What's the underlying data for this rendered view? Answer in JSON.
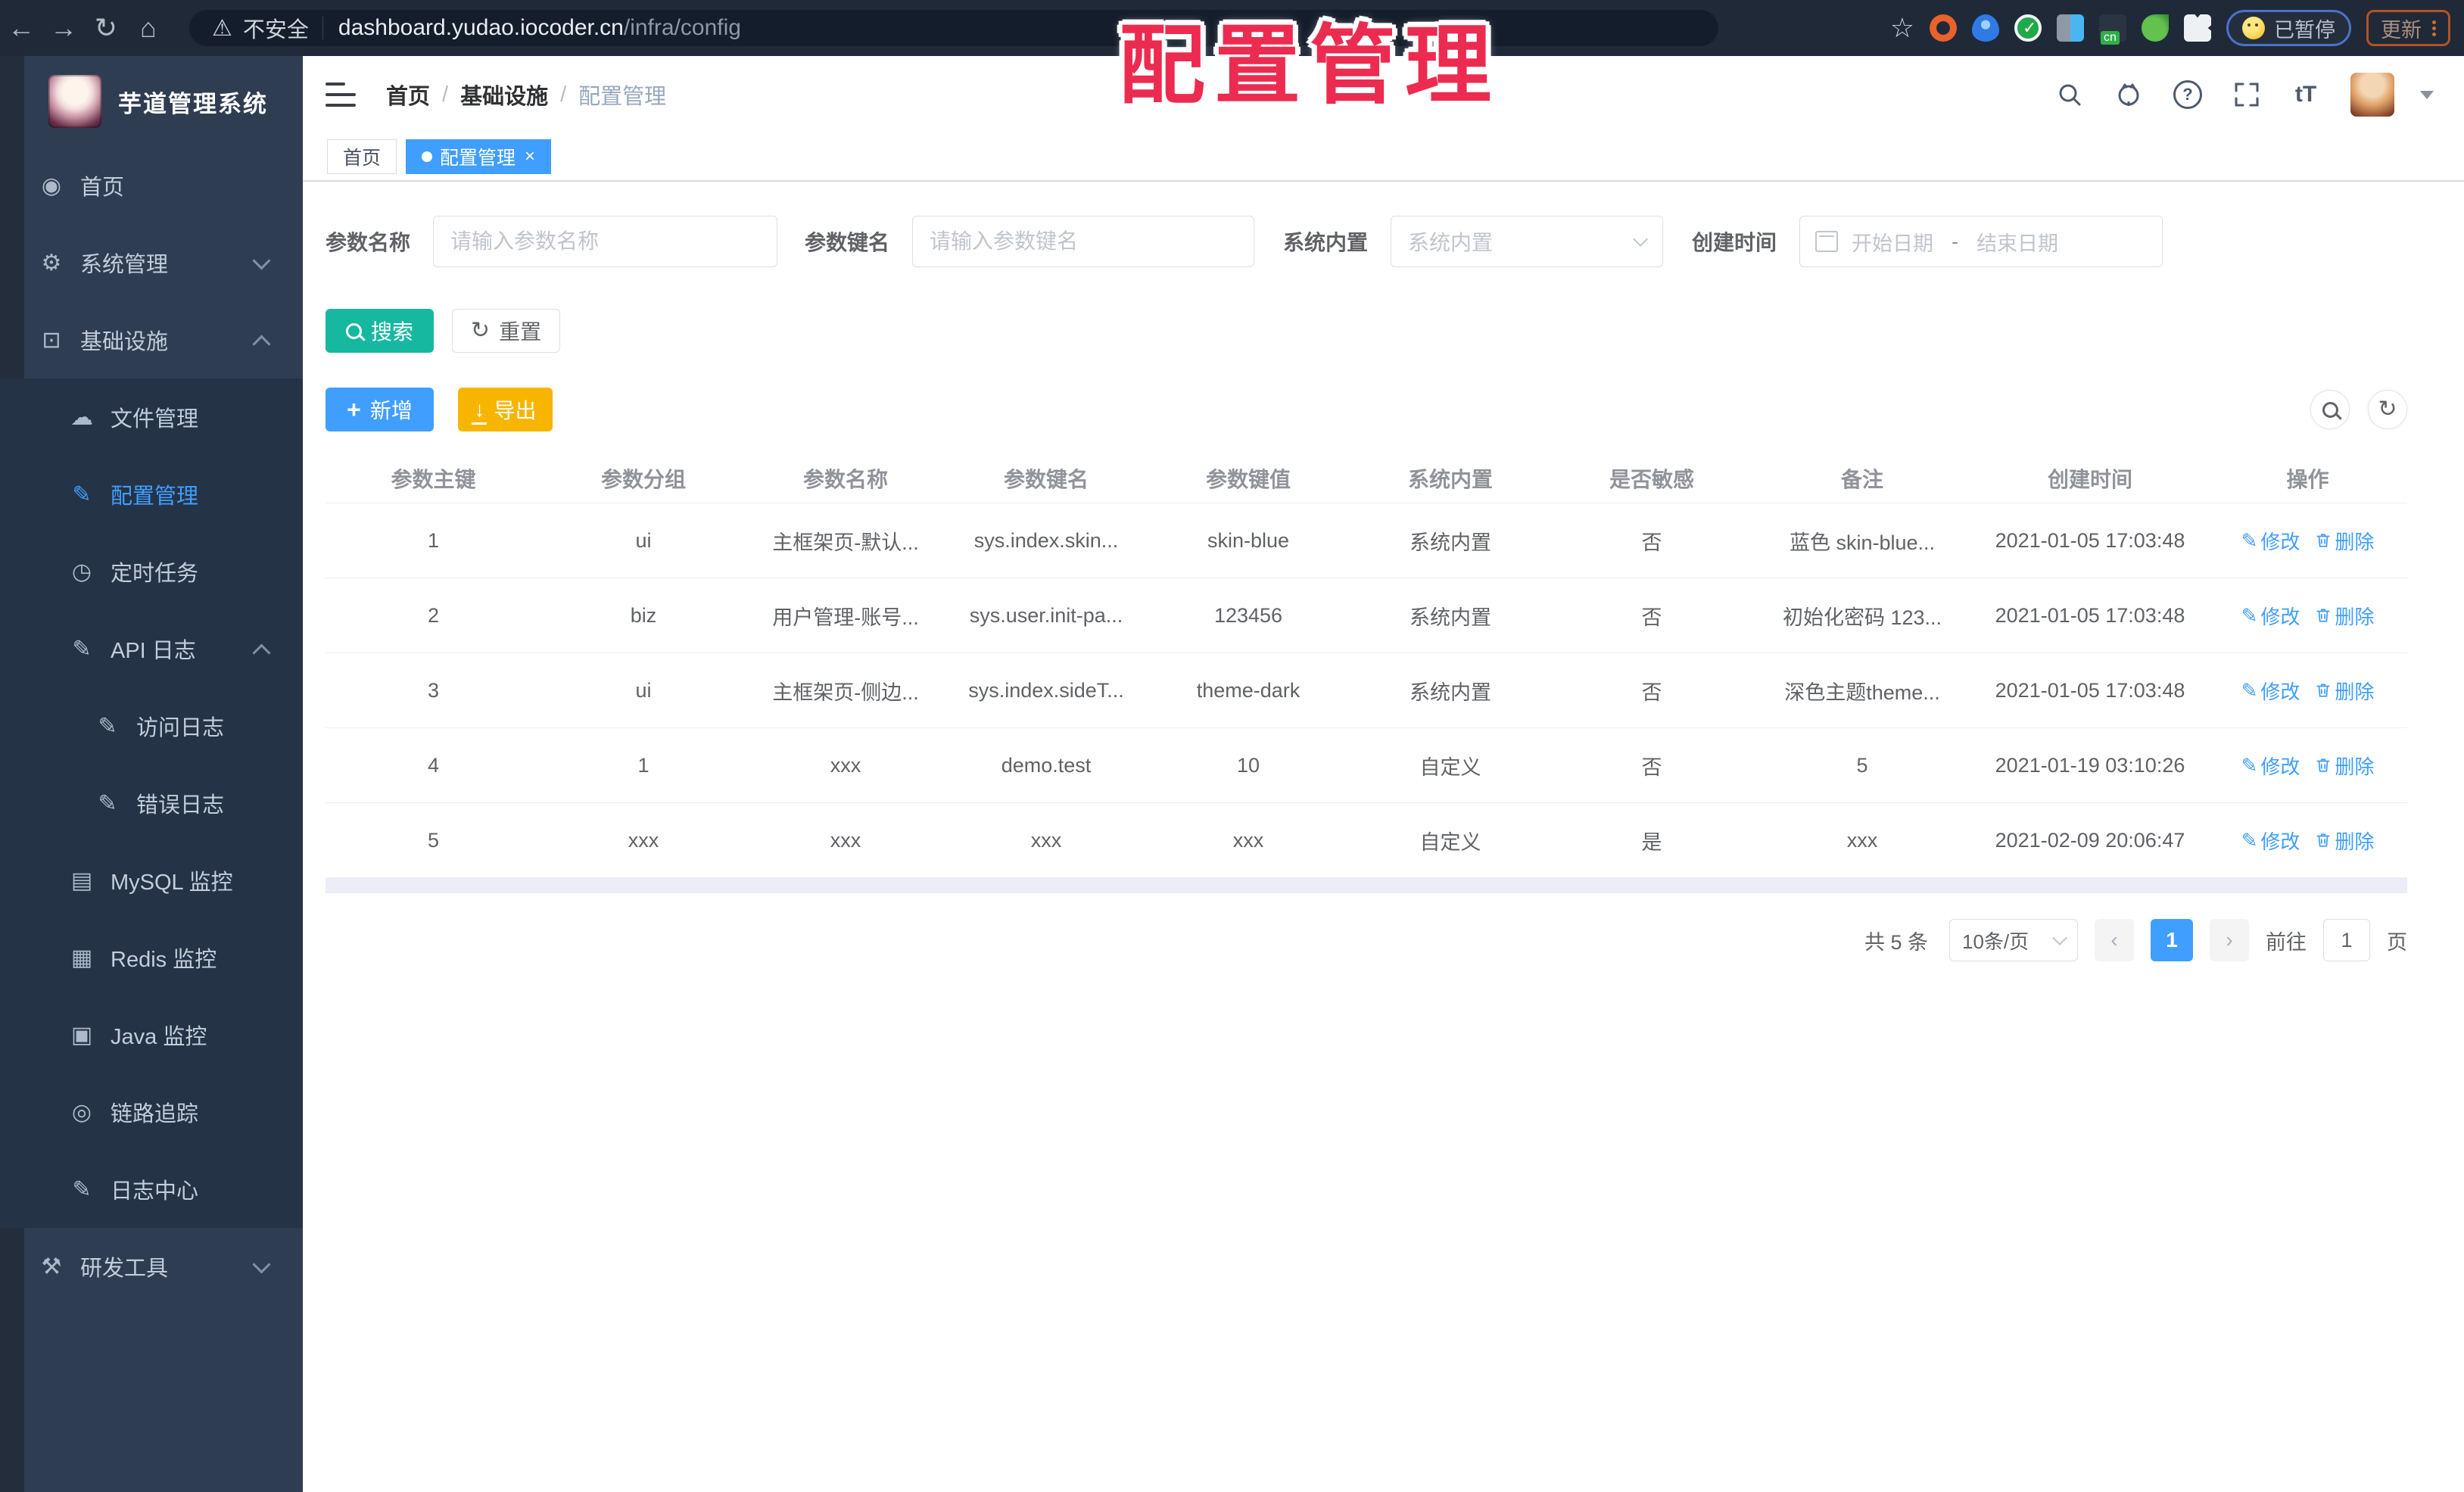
{
  "browser": {
    "security_label": "不安全",
    "url_host": "dashboard.yudao.iocoder.cn",
    "url_path": "/infra/config",
    "cn_badge": "cn",
    "paused_label": "已暂停",
    "update_label": "更新"
  },
  "overlay_title": "配置管理",
  "colors": {
    "accent_blue": "#409eff",
    "search_teal": "#16b8a0",
    "export_yellow": "#f7b500",
    "overlay_red": "#ec2b50",
    "sidebar_bg": "#2f3d52",
    "submenu_bg": "#243346"
  },
  "sidebar": {
    "app_title": "芋道管理系统",
    "menu": [
      {
        "id": "home",
        "label": "首页",
        "icon": "dashboard-icon",
        "level": 1
      },
      {
        "id": "system",
        "label": "系统管理",
        "icon": "gear-icon",
        "level": 1,
        "chevron": "down"
      },
      {
        "id": "infra",
        "label": "基础设施",
        "icon": "infra-monitor-icon",
        "level": 1,
        "chevron": "up"
      },
      {
        "id": "file",
        "label": "文件管理",
        "icon": "cloud-upload-icon",
        "level": 2,
        "group": true
      },
      {
        "id": "config",
        "label": "配置管理",
        "icon": "config-edit-icon",
        "level": 2,
        "group": true,
        "active": true
      },
      {
        "id": "job",
        "label": "定时任务",
        "icon": "timer-icon",
        "level": 2,
        "group": true
      },
      {
        "id": "api-log",
        "label": "API 日志",
        "icon": "api-log-icon",
        "level": 2,
        "group": true,
        "chevron": "up"
      },
      {
        "id": "access-log",
        "label": "访问日志",
        "icon": "access-log-icon",
        "level": 3,
        "group": true
      },
      {
        "id": "error-log",
        "label": "错误日志",
        "icon": "error-log-icon",
        "level": 3,
        "group": true
      },
      {
        "id": "mysql",
        "label": "MySQL 监控",
        "icon": "mysql-monitor-icon",
        "level": 2,
        "group": true
      },
      {
        "id": "redis",
        "label": "Redis 监控",
        "icon": "redis-monitor-icon",
        "level": 2,
        "group": true
      },
      {
        "id": "java",
        "label": "Java 监控",
        "icon": "java-monitor-icon",
        "level": 2,
        "group": true
      },
      {
        "id": "trace",
        "label": "链路追踪",
        "icon": "trace-eye-icon",
        "level": 2,
        "group": true
      },
      {
        "id": "log-center",
        "label": "日志中心",
        "icon": "log-center-icon",
        "level": 2,
        "group": true
      },
      {
        "id": "devtools",
        "label": "研发工具",
        "icon": "devtools-icon",
        "level": 1,
        "chevron": "down"
      }
    ]
  },
  "breadcrumb": [
    "首页",
    "基础设施",
    "配置管理"
  ],
  "tabs": [
    {
      "label": "首页",
      "active": false
    },
    {
      "label": "配置管理",
      "active": true
    }
  ],
  "filters": {
    "name_label": "参数名称",
    "name_placeholder": "请输入参数名称",
    "key_label": "参数键名",
    "key_placeholder": "请输入参数键名",
    "type_label": "系统内置",
    "type_placeholder": "系统内置",
    "date_label": "创建时间",
    "date_start_placeholder": "开始日期",
    "date_separator": "-",
    "date_end_placeholder": "结束日期",
    "search_button": "搜索",
    "reset_button": "重置"
  },
  "toolbar": {
    "add_button": "新增",
    "export_button": "导出"
  },
  "table": {
    "columns": [
      "参数主键",
      "参数分组",
      "参数名称",
      "参数键名",
      "参数键值",
      "系统内置",
      "是否敏感",
      "备注",
      "创建时间",
      "操作"
    ],
    "edit_label": "修改",
    "delete_label": "删除",
    "rows": [
      {
        "id": "1",
        "group": "ui",
        "name": "主框架页-默认...",
        "key": "sys.index.skin...",
        "value": "skin-blue",
        "type": "系统内置",
        "sensitive": "否",
        "remark": "蓝色 skin-blue...",
        "created": "2021-01-05 17:03:48"
      },
      {
        "id": "2",
        "group": "biz",
        "name": "用户管理-账号...",
        "key": "sys.user.init-pa...",
        "value": "123456",
        "type": "系统内置",
        "sensitive": "否",
        "remark": "初始化密码 123...",
        "created": "2021-01-05 17:03:48"
      },
      {
        "id": "3",
        "group": "ui",
        "name": "主框架页-侧边...",
        "key": "sys.index.sideT...",
        "value": "theme-dark",
        "type": "系统内置",
        "sensitive": "否",
        "remark": "深色主题theme...",
        "created": "2021-01-05 17:03:48"
      },
      {
        "id": "4",
        "group": "1",
        "name": "xxx",
        "key": "demo.test",
        "value": "10",
        "type": "自定义",
        "sensitive": "否",
        "remark": "5",
        "created": "2021-01-19 03:10:26"
      },
      {
        "id": "5",
        "group": "xxx",
        "name": "xxx",
        "key": "xxx",
        "value": "xxx",
        "type": "自定义",
        "sensitive": "是",
        "remark": "xxx",
        "created": "2021-02-09 20:06:47"
      }
    ]
  },
  "pagination": {
    "total": "共 5 条",
    "page_size": "10条/页",
    "current_page": "1",
    "goto_label": "前往",
    "goto_value": "1",
    "page_unit": "页"
  }
}
